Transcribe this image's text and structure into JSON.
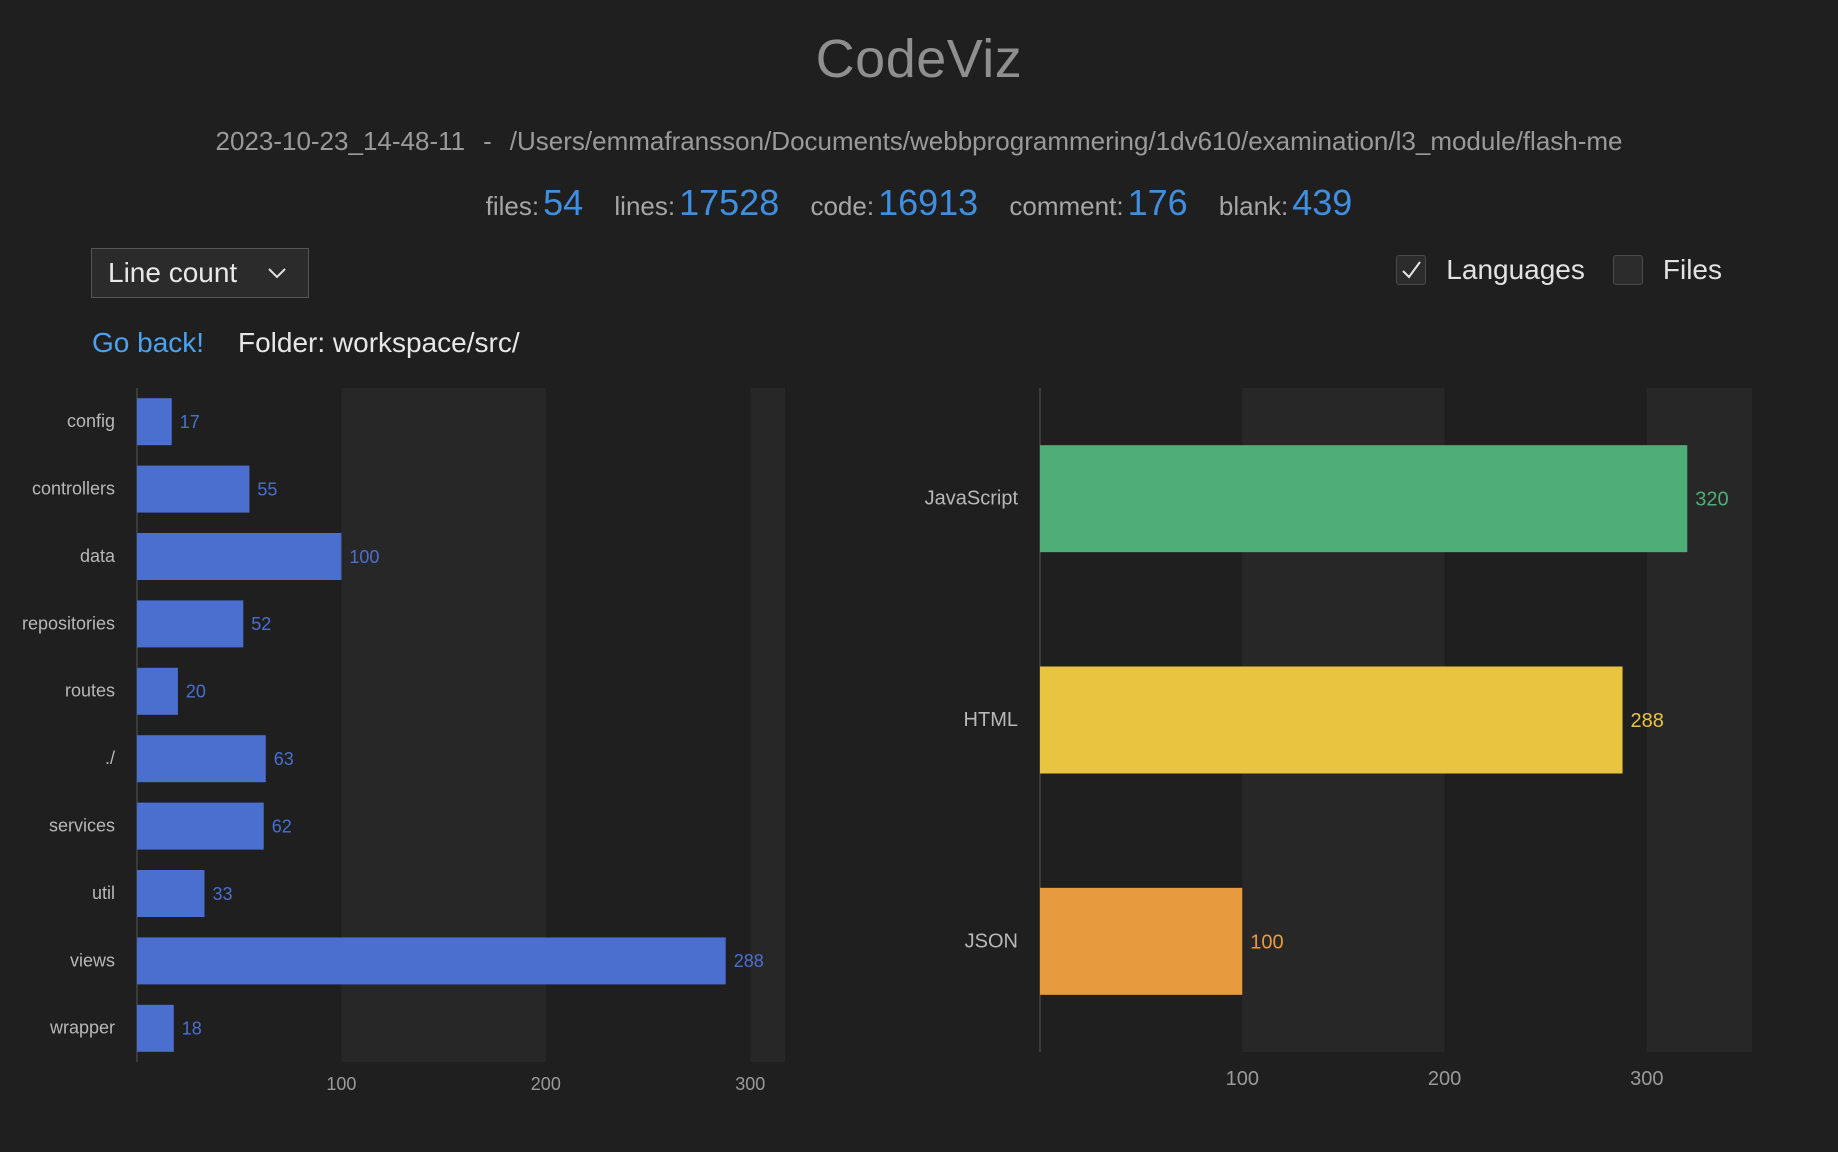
{
  "app": {
    "title": "CodeViz"
  },
  "meta": {
    "timestamp": "2023-10-23_14-48-11",
    "separator": "-",
    "path": "/Users/emmafransson/Documents/webbprogrammering/1dv610/examination/l3_module/flash-me"
  },
  "stats": [
    {
      "label": "files:",
      "value": "54"
    },
    {
      "label": "lines:",
      "value": "17528"
    },
    {
      "label": "code:",
      "value": "16913"
    },
    {
      "label": "comment:",
      "value": "176"
    },
    {
      "label": "blank:",
      "value": "439"
    }
  ],
  "controls": {
    "metric_select": {
      "selected": "Line count"
    },
    "languages": {
      "label": "Languages",
      "checked": true
    },
    "files": {
      "label": "Files",
      "checked": false
    }
  },
  "nav": {
    "go_back": "Go back!",
    "folder": "Folder: workspace/src/"
  },
  "colors": {
    "accent": "#3f8fe0",
    "link": "#4aa3f0",
    "folder_bar": "#4a6fcf",
    "javascript": "#4fad77",
    "html": "#e9c440",
    "json": "#e89a3e"
  },
  "chart_data": [
    {
      "type": "bar",
      "orientation": "horizontal",
      "categories": [
        "config",
        "controllers",
        "data",
        "repositories",
        "routes",
        "./",
        "services",
        "util",
        "views",
        "wrapper"
      ],
      "values": [
        17,
        55,
        100,
        52,
        20,
        63,
        62,
        33,
        288,
        18
      ],
      "colors": [
        "#4a6fcf"
      ],
      "data_labels": true,
      "xlim": [
        0,
        317
      ],
      "xticks": [
        100,
        200,
        300
      ],
      "grid": "alternating-bands"
    },
    {
      "type": "bar",
      "orientation": "horizontal",
      "categories": [
        "JavaScript",
        "HTML",
        "JSON"
      ],
      "values": [
        320,
        288,
        100
      ],
      "colors": [
        "#4fad77",
        "#e9c440",
        "#e89a3e"
      ],
      "data_labels": true,
      "xlim": [
        0,
        352
      ],
      "xticks": [
        100,
        200,
        300
      ],
      "grid": "alternating-bands"
    }
  ]
}
